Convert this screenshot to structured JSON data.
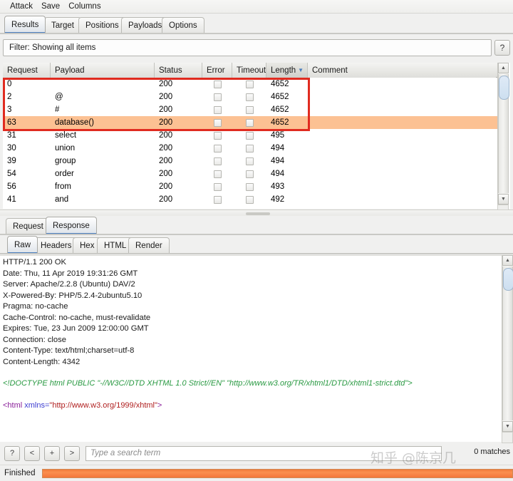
{
  "menubar": {
    "items": [
      {
        "label": "Attack"
      },
      {
        "label": "Save"
      },
      {
        "label": "Columns"
      }
    ]
  },
  "main_tabs": [
    {
      "label": "Results",
      "selected": true
    },
    {
      "label": "Target",
      "selected": false
    },
    {
      "label": "Positions",
      "selected": false
    },
    {
      "label": "Payloads",
      "selected": false
    },
    {
      "label": "Options",
      "selected": false
    }
  ],
  "filter": {
    "text": "Filter: Showing all items",
    "help_label": "?"
  },
  "results_table": {
    "columns": [
      {
        "label": "Request",
        "sorted": false
      },
      {
        "label": "Payload",
        "sorted": false
      },
      {
        "label": "Status",
        "sorted": false
      },
      {
        "label": "Error",
        "sorted": false
      },
      {
        "label": "Timeout",
        "sorted": false
      },
      {
        "label": "Length",
        "sorted": true,
        "sort_dir": "▼"
      },
      {
        "label": "Comment",
        "sorted": false
      }
    ],
    "rows": [
      {
        "request": "0",
        "payload": "",
        "status": "200",
        "error": false,
        "timeout": false,
        "length": "4652",
        "comment": "",
        "highlight": false
      },
      {
        "request": "2",
        "payload": "@",
        "status": "200",
        "error": false,
        "timeout": false,
        "length": "4652",
        "comment": "",
        "highlight": false
      },
      {
        "request": "3",
        "payload": "#",
        "status": "200",
        "error": false,
        "timeout": false,
        "length": "4652",
        "comment": "",
        "highlight": false
      },
      {
        "request": "63",
        "payload": "database()",
        "status": "200",
        "error": false,
        "timeout": false,
        "length": "4652",
        "comment": "",
        "highlight": true
      },
      {
        "request": "31",
        "payload": "select",
        "status": "200",
        "error": false,
        "timeout": false,
        "length": "495",
        "comment": "",
        "highlight": false
      },
      {
        "request": "30",
        "payload": "union",
        "status": "200",
        "error": false,
        "timeout": false,
        "length": "494",
        "comment": "",
        "highlight": false
      },
      {
        "request": "39",
        "payload": "group",
        "status": "200",
        "error": false,
        "timeout": false,
        "length": "494",
        "comment": "",
        "highlight": false
      },
      {
        "request": "54",
        "payload": "order",
        "status": "200",
        "error": false,
        "timeout": false,
        "length": "494",
        "comment": "",
        "highlight": false
      },
      {
        "request": "56",
        "payload": "from",
        "status": "200",
        "error": false,
        "timeout": false,
        "length": "493",
        "comment": "",
        "highlight": false
      },
      {
        "request": "41",
        "payload": "and",
        "status": "200",
        "error": false,
        "timeout": false,
        "length": "492",
        "comment": "",
        "highlight": false
      }
    ]
  },
  "message_tabs": [
    {
      "label": "Request",
      "selected": false
    },
    {
      "label": "Response",
      "selected": true
    }
  ],
  "view_tabs": [
    {
      "label": "Raw",
      "selected": true
    },
    {
      "label": "Headers",
      "selected": false
    },
    {
      "label": "Hex",
      "selected": false
    },
    {
      "label": "HTML",
      "selected": false
    },
    {
      "label": "Render",
      "selected": false
    }
  ],
  "response": {
    "headers": [
      "HTTP/1.1 200 OK",
      "Date: Thu, 11 Apr 2019 19:31:26 GMT",
      "Server: Apache/2.2.8 (Ubuntu) DAV/2",
      "X-Powered-By: PHP/5.2.4-2ubuntu5.10",
      "Pragma: no-cache",
      "Cache-Control: no-cache, must-revalidate",
      "Expires: Tue, 23 Jun 2009 12:00:00 GMT",
      "Connection: close",
      "Content-Type: text/html;charset=utf-8",
      "Content-Length: 4342"
    ],
    "doctype": "<!DOCTYPE html PUBLIC \"-//W3C//DTD XHTML 1.0 Strict//EN\" \"http://www.w3.org/TR/xhtml1/DTD/xhtml1-strict.dtd\">",
    "html_open_tag": {
      "open": "<html ",
      "attr": "xmlns=",
      "value": "\"http://www.w3.org/1999/xhtml\"",
      "close": ">"
    }
  },
  "search": {
    "help_label": "?",
    "prev_label": "<",
    "plus_label": "+",
    "next_label": ">",
    "placeholder": "Type a search term",
    "value": "",
    "matches": "0 matches"
  },
  "status": {
    "label": "Finished",
    "progress_percent": 100
  },
  "watermark": {
    "text": "知乎 @陈京几"
  },
  "colors": {
    "highlight_row": "#fcc193",
    "red_box": "#e02b20",
    "progress": "#f4763a",
    "sort_accent": "#4a7dbd",
    "doctype_green": "#2a9a43"
  }
}
